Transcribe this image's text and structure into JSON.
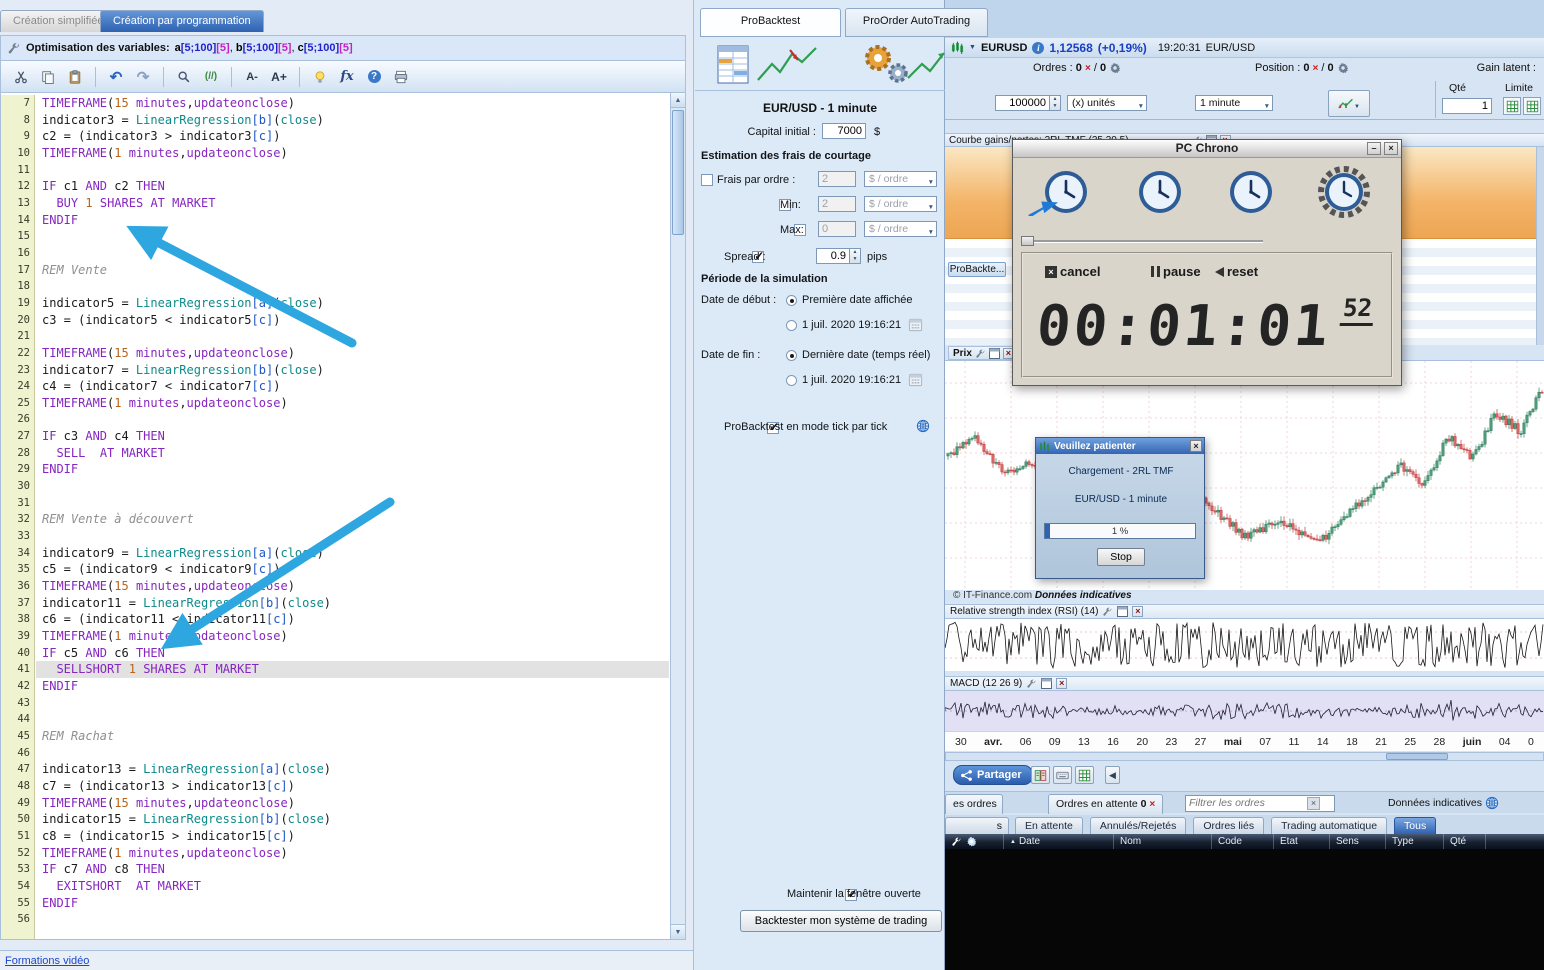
{
  "app": {
    "statusbar_link": "Formations vidéo"
  },
  "editor": {
    "tabs": {
      "simple": "Création simplifiée",
      "program": "Création par programmation"
    },
    "optimization": {
      "label": "Optimisation des variables:",
      "variables": [
        {
          "name": "a",
          "range": "[5;100]",
          "step": "[5]"
        },
        {
          "name": "b",
          "range": "[5;100]",
          "step": "[5]"
        },
        {
          "name": "c",
          "range": "[5;100]",
          "step": "[5]"
        }
      ]
    },
    "toolbar_buttons": [
      "cut",
      "copy",
      "paste",
      "undo",
      "redo",
      "search",
      "comment",
      "font-smaller",
      "font-larger",
      "hint",
      "function",
      "help",
      "print"
    ],
    "first_line_number": 7,
    "highlighted_line": 41,
    "code_lines": [
      "TIMEFRAME(15 minutes,updateonclose)",
      "indicator3 = LinearRegression[b](close)",
      "c2 = (indicator3 > indicator3[c])",
      "TIMEFRAME(1 minutes,updateonclose)",
      "",
      "IF c1 AND c2 THEN",
      "  BUY 1 SHARES AT MARKET",
      "ENDIF",
      "",
      "",
      "REM Vente",
      "",
      "indicator5 = LinearRegression[a](close)",
      "c3 = (indicator5 < indicator5[c])",
      "",
      "TIMEFRAME(15 minutes,updateonclose)",
      "indicator7 = LinearRegression[b](close)",
      "c4 = (indicator7 < indicator7[c])",
      "TIMEFRAME(1 minutes,updateonclose)",
      "",
      "IF c3 AND c4 THEN",
      "  SELL  AT MARKET",
      "ENDIF",
      "",
      "",
      "REM Vente à découvert",
      "",
      "indicator9 = LinearRegression[a](close)",
      "c5 = (indicator9 < indicator9[c])",
      "TIMEFRAME(15 minutes,updateonclose)",
      "indicator11 = LinearRegression[b](close)",
      "c6 = (indicator11 < indicator11[c])",
      "TIMEFRAME(1 minutes,updateonclose)",
      "IF c5 AND c6 THEN",
      "  SELLSHORT 1 SHARES AT MARKET",
      "ENDIF",
      "",
      "",
      "REM Rachat",
      "",
      "indicator13 = LinearRegression[a](close)",
      "c7 = (indicator13 > indicator13[c])",
      "TIMEFRAME(15 minutes,updateonclose)",
      "indicator15 = LinearRegression[b](close)",
      "c8 = (indicator15 > indicator15[c])",
      "TIMEFRAME(1 minutes,updateonclose)",
      "IF c7 AND c8 THEN",
      "  EXITSHORT  AT MARKET",
      "ENDIF",
      ""
    ]
  },
  "backtest": {
    "tab_probacktest": "ProBacktest",
    "tab_proorder": "ProOrder AutoTrading",
    "instrument": "EUR/USD - 1 minute",
    "capital_label": "Capital initial :",
    "capital_value": "7000",
    "capital_unit": "$",
    "fees_title": "Estimation des frais de courtage",
    "fee_order_label": "Frais par ordre :",
    "fee_order_value": "2",
    "fee_min_label": "Min:",
    "fee_min_value": "2",
    "fee_max_label": "Max:",
    "fee_max_value": "0",
    "fee_unit": "$ / ordre",
    "spread_label": "Spread :",
    "spread_value": "0.9",
    "spread_unit": "pips",
    "period_title": "Période de la simulation",
    "start_label": "Date de début :",
    "start_opt1": "Première date affichée",
    "start_opt2": "1 juil. 2020 19:16:21",
    "end_label": "Date de fin :",
    "end_opt1": "Dernière date (temps réel)",
    "end_opt2": "1 juil. 2020 19:16:21",
    "tick_label": "ProBacktest en mode tick par tick",
    "keep_open_label": "Maintenir la fenêtre ouverte",
    "run_label": "Backtester mon système de trading"
  },
  "market": {
    "symbol": "EURUSD",
    "price": "1,12568",
    "change": "(+0,19%)",
    "time": "19:20:31",
    "pair": "EUR/USD",
    "orders_label": "Ordres :",
    "orders_open": "0",
    "orders_total": "0",
    "position_label": "Position :",
    "position_open": "0",
    "position_total": "0",
    "gain_label": "Gain latent :",
    "qty_label": "Qté",
    "limit_label": "Limite",
    "qty_value": "1",
    "order_qty": "100000",
    "unit_mode": "(x) unités",
    "timeframe": "1 minute"
  },
  "gains_window": {
    "title": "Courbe gains/pertes: 2RL TMF (25 30 5)",
    "side_tab": "ProBackte..."
  },
  "price_panel": {
    "label": "Prix"
  },
  "chart": {
    "copyright": "© IT-Finance.com",
    "indicative": "Données indicatives",
    "rsi_title": "Relative strength index (RSI) (14)",
    "macd_title": "MACD (12 26 9)",
    "x_labels": [
      "30",
      "avr.",
      "06",
      "09",
      "13",
      "16",
      "20",
      "23",
      "27",
      "mai",
      "07",
      "11",
      "14",
      "18",
      "21",
      "25",
      "28",
      "juin",
      "04",
      "0"
    ],
    "months": [
      "avr.",
      "mai",
      "juin"
    ],
    "share_label": "Partager"
  },
  "chrono": {
    "title": "PC Chrono",
    "cancel_label": "cancel",
    "pause_label": "pause",
    "reset_label": "reset",
    "hours": "00",
    "minutes": "01",
    "seconds": "01",
    "centiseconds": "52"
  },
  "loading": {
    "title": "Veuillez patienter",
    "message1": "Chargement - 2RL TMF",
    "message2": "EUR/USD - 1 minute",
    "progress_text": "1 %",
    "stop_label": "Stop"
  },
  "orders": {
    "list_tab_fragment": "es ordres",
    "pending_tab": "Ordres en attente",
    "pending_count": "0",
    "filter_placeholder": "Filtrer les ordres",
    "indicative_label": "Données indicatives",
    "subtab_fragment": "s",
    "subtabs": [
      "En attente",
      "Annulés/Rejetés",
      "Ordres liés",
      "Trading automatique",
      "Tous"
    ],
    "active_subtab": "Tous",
    "columns": [
      "Date",
      "Nom",
      "Code",
      "Etat",
      "Sens",
      "Type",
      "Qté"
    ]
  }
}
